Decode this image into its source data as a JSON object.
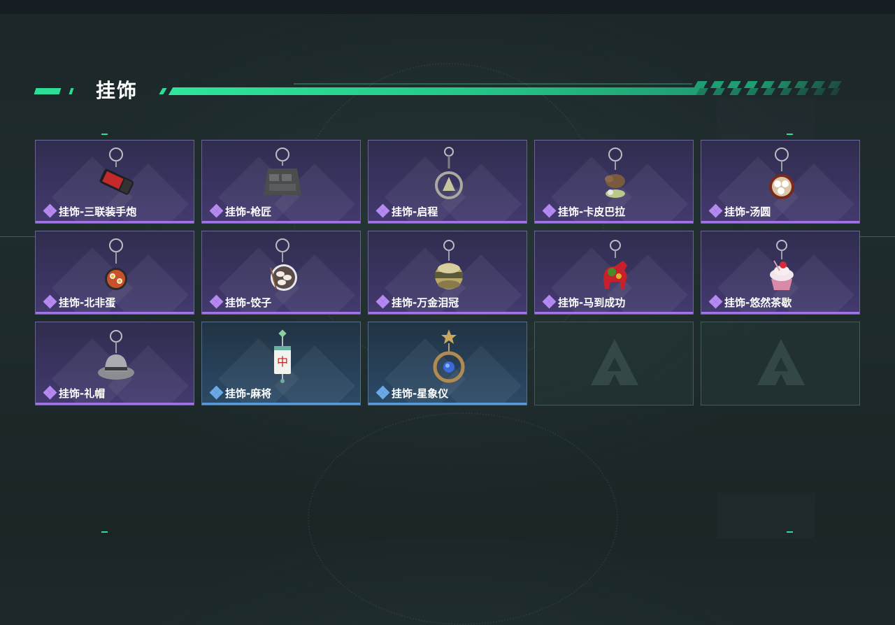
{
  "header": {
    "title": "挂饰"
  },
  "colors": {
    "accent": "#2ddf96",
    "purple_rarity": "#a273e6",
    "blue_rarity": "#5a9ad8"
  },
  "items": [
    {
      "label": "挂饰-三联装手炮",
      "rarity": "purple",
      "icon": "triple-hand-cannon-charm-icon"
    },
    {
      "label": "挂饰-枪匠",
      "rarity": "purple",
      "icon": "gunsmith-vest-charm-icon"
    },
    {
      "label": "挂饰-启程",
      "rarity": "purple",
      "icon": "departure-emblem-charm-icon"
    },
    {
      "label": "挂饰-卡皮巴拉",
      "rarity": "purple",
      "icon": "capybara-charm-icon"
    },
    {
      "label": "挂饰-汤圆",
      "rarity": "purple",
      "icon": "tangyuan-bowl-charm-icon"
    },
    {
      "label": "挂饰-北非蛋",
      "rarity": "purple",
      "icon": "shakshuka-pan-charm-icon"
    },
    {
      "label": "挂饰-饺子",
      "rarity": "purple",
      "icon": "dumpling-plate-charm-icon"
    },
    {
      "label": "挂饰-万金泪冠",
      "rarity": "purple",
      "icon": "crown-charm-icon"
    },
    {
      "label": "挂饰-马到成功",
      "rarity": "purple",
      "icon": "red-horse-charm-icon"
    },
    {
      "label": "挂饰-悠然茶歇",
      "rarity": "purple",
      "icon": "cupcake-charm-icon"
    },
    {
      "label": "挂饰-礼帽",
      "rarity": "purple",
      "icon": "fedora-hat-charm-icon"
    },
    {
      "label": "挂饰-麻将",
      "rarity": "blue",
      "icon": "mahjong-tile-charm-icon"
    },
    {
      "label": "挂饰-星象仪",
      "rarity": "blue",
      "icon": "astrolabe-charm-icon"
    },
    {
      "label": "",
      "rarity": "empty",
      "icon": "empty-slot-logo-icon"
    },
    {
      "label": "",
      "rarity": "empty",
      "icon": "empty-slot-logo-icon"
    }
  ]
}
